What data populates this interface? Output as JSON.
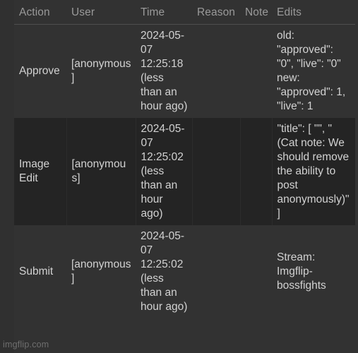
{
  "table": {
    "headers": [
      {
        "key": "action",
        "label": "Action"
      },
      {
        "key": "user",
        "label": "User"
      },
      {
        "key": "time",
        "label": "Time"
      },
      {
        "key": "reason",
        "label": "Reason"
      },
      {
        "key": "note",
        "label": "Note"
      },
      {
        "key": "edits",
        "label": "Edits"
      }
    ],
    "rows": [
      {
        "action": "Approve",
        "user": "[anonymous]",
        "time": "2024-05-07 12:25:18 (less than an hour ago)",
        "reason": "",
        "note": "",
        "edits": "old: \"approved\": \"0\", \"live\": \"0\" new: \"approved\": 1, \"live\": 1"
      },
      {
        "action": "Image Edit",
        "user": "[anonymous]",
        "time": "2024-05-07 12:25:02 (less than an hour ago)",
        "reason": "",
        "note": "",
        "edits": "\"title\": [ \"\", \"(Cat note: We should remove the ability to post anonymously)\" ]"
      },
      {
        "action": "Submit",
        "user": "[anonymous]",
        "time": "2024-05-07 12:25:02 (less than an hour ago)",
        "reason": "",
        "note": "",
        "edits": "Stream: Imgflip-bossfights"
      }
    ]
  },
  "watermark": {
    "text": "imgflip.com"
  },
  "colors": {
    "page_background": "#323232",
    "row_alt_background": "#242424",
    "header_text": "#9a9a9a",
    "body_text": "#d2d2d2",
    "divider": "#4e4e4e",
    "watermark_text": "#6e6e6e"
  }
}
